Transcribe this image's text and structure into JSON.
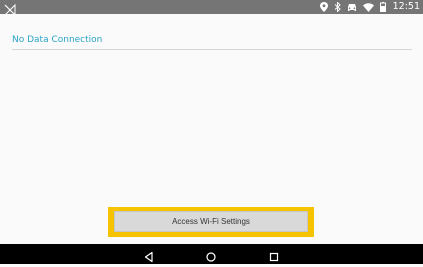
{
  "status_bar": {
    "time": "12:51",
    "left_icon": "no-signal-icon",
    "right_icons": [
      "location-icon",
      "bluetooth-icon",
      "car-icon",
      "wifi-icon",
      "battery-icon"
    ]
  },
  "main": {
    "header": "No Data Connection"
  },
  "button": {
    "label": "Access Wi-Fi Settings"
  },
  "nav_bar": {
    "icons": [
      "back-icon",
      "home-icon",
      "recent-apps-icon"
    ]
  },
  "colors": {
    "accent": "#2aa4c8",
    "highlight": "#f5c300",
    "status_bar": "#757575",
    "nav_bar": "#000000"
  }
}
